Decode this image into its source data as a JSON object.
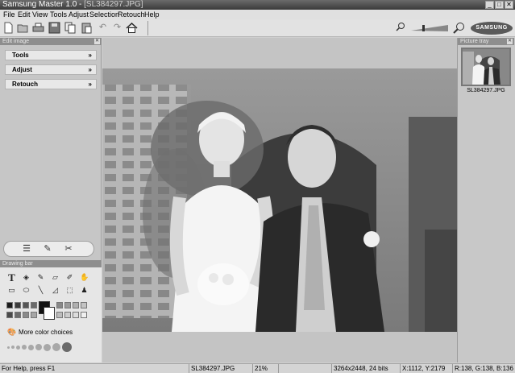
{
  "window": {
    "app_title": "Samsung Master 1.0 - ",
    "file_title": "[SL384297.JPG]",
    "buttons": {
      "minimize": "_",
      "maximize": "□",
      "close": "✕"
    }
  },
  "menu": [
    "File",
    "Edit",
    "View",
    "Tools",
    "Adjust",
    "Selection",
    "Retouch",
    "Help"
  ],
  "toolbar": {
    "icons": [
      "new-icon",
      "open-icon",
      "print-icon",
      "save-icon",
      "copy-icon",
      "paste-icon",
      "undo-icon",
      "redo-icon",
      "home-icon"
    ],
    "zoom_icons": [
      "zoom-out-icon",
      "zoom-in-icon"
    ],
    "logo": "SAMSUNG"
  },
  "edit_panel": {
    "header": "Edit image",
    "sections": [
      {
        "label": "Tools",
        "chevron": "»"
      },
      {
        "label": "Adjust",
        "chevron": "»"
      },
      {
        "label": "Retouch",
        "chevron": "»"
      }
    ]
  },
  "drawing_panel": {
    "header": "Drawing bar",
    "tools_row1": [
      "text-tool-icon",
      "fill-tool-icon",
      "brush-tool-icon",
      "eraser-tool-icon",
      "pencil-tool-icon",
      "hand-tool-icon"
    ],
    "tools_row2": [
      "rectangle-tool-icon",
      "ellipse-tool-icon",
      "line-tool-icon",
      "polygon-tool-icon",
      "select-tool-icon",
      "stamp-tool-icon"
    ],
    "palette_row1": [
      "#1a1a1a",
      "#3a3a3a",
      "#555555",
      "#6a6a6a",
      "#888888",
      "#9a9a9a",
      "#b0b0b0",
      "#c4c4c4"
    ],
    "palette_row2": [
      "#4a4a4a",
      "#6c6c6c",
      "#8a8a8a",
      "#a6a6a6",
      "#bcbcbc",
      "#cccccc",
      "#dddddd",
      "#f0f0f0"
    ],
    "foreground": "#111111",
    "background": "#ffffff",
    "more_colors": "More color choices"
  },
  "tray": {
    "header": "Picture tray",
    "items": [
      {
        "filename": "SL384297.JPG"
      }
    ]
  },
  "status": {
    "help": "For Help, press F1",
    "file": "SL384297.JPG",
    "zoom": "21%",
    "dimensions": "3264x2448, 24 bits",
    "coords": "X:1112, Y:2179",
    "rgb": "R:138, G:138, B:136"
  }
}
